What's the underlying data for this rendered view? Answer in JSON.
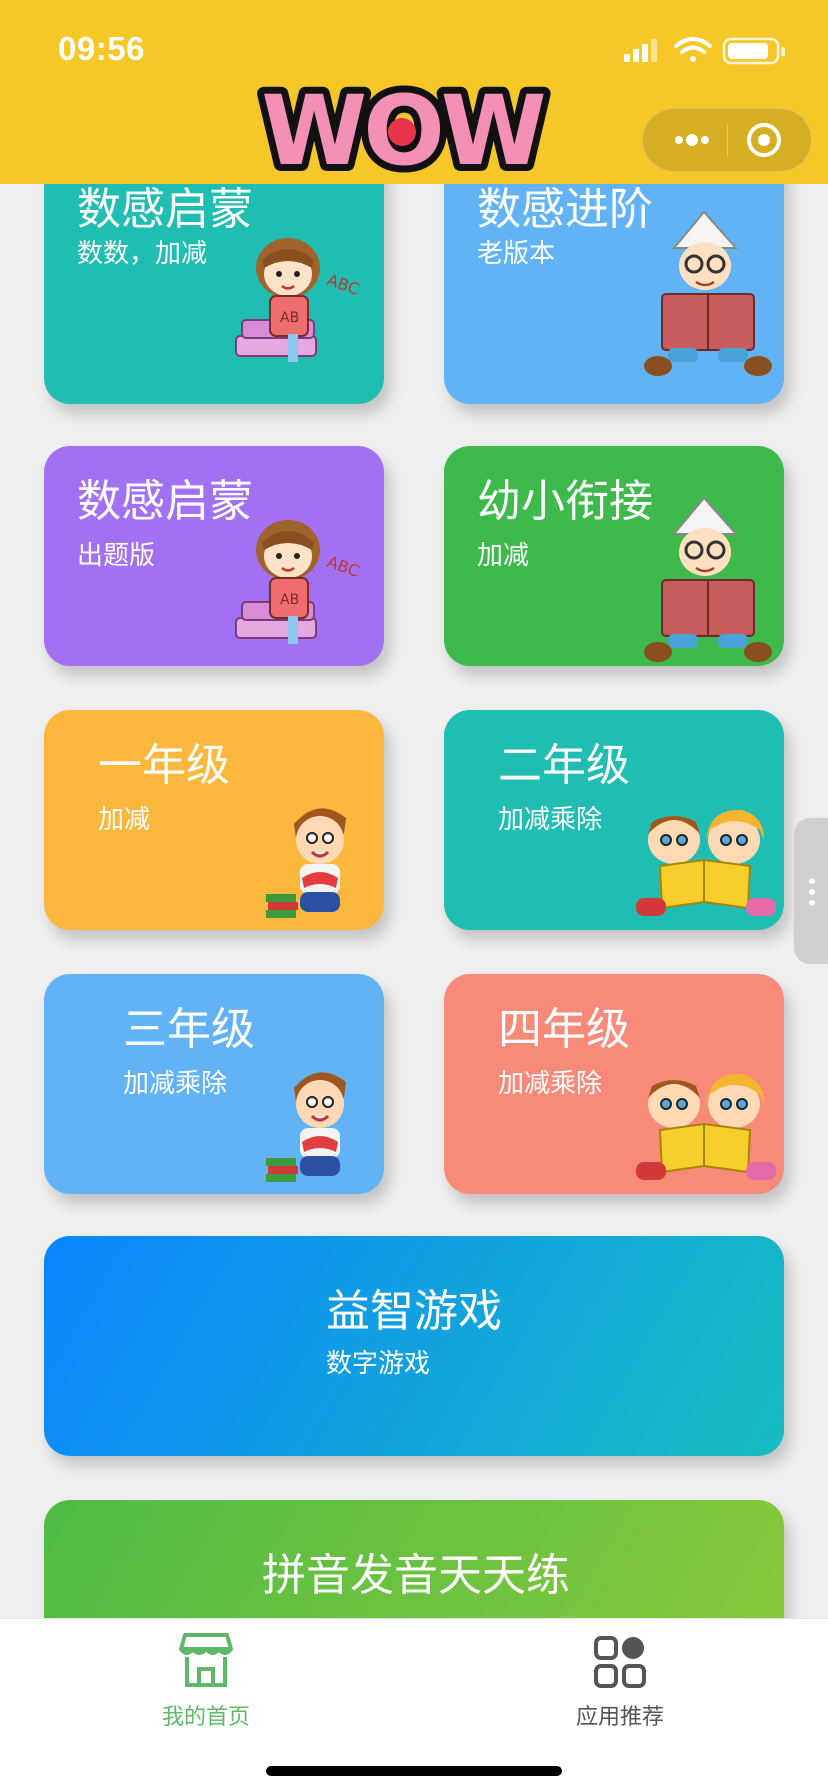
{
  "status_bar": {
    "time": "09:56"
  },
  "header": {
    "logo_text": "WOW",
    "capsule": {
      "more_icon": "more-dots-icon",
      "close_icon": "target-circle-icon"
    }
  },
  "cards": [
    {
      "title": "数感启蒙",
      "subtitle": "数数，加减",
      "color": "#1fbdb2",
      "illustration": "girl-reading-icon"
    },
    {
      "title": "数感进阶",
      "subtitle": "老版本",
      "color": "#62b3f6",
      "illustration": "boy-reading-hat-icon"
    },
    {
      "title": "数感启蒙",
      "subtitle": "出题版",
      "color": "#a271f3",
      "illustration": "girl-reading-icon"
    },
    {
      "title": "幼小衔接",
      "subtitle": "加减",
      "color": "#3eb94b",
      "illustration": "boy-reading-hat-icon"
    },
    {
      "title": "一年级",
      "subtitle": "加减",
      "color": "#fbb83c",
      "illustration": "boy-with-books-icon"
    },
    {
      "title": "二年级",
      "subtitle": "加减乘除",
      "color": "#1fbdb2",
      "illustration": "two-kids-reading-icon"
    },
    {
      "title": "三年级",
      "subtitle": "加减乘除",
      "color": "#62b3f6",
      "illustration": "boy-with-books-icon"
    },
    {
      "title": "四年级",
      "subtitle": "加减乘除",
      "color": "#f78a78",
      "illustration": "two-kids-reading-icon"
    },
    {
      "title": "益智游戏",
      "subtitle": "数字游戏",
      "gradient": [
        "#0a86ff",
        "#18bcc0"
      ]
    },
    {
      "title": "拼音发音天天练",
      "subtitle": "",
      "gradient": [
        "#4fbb45",
        "#8ac93a"
      ]
    }
  ],
  "tabbar": {
    "items": [
      {
        "label": "我的首页",
        "icon": "store-home-icon",
        "active": true,
        "color": "#5db86a"
      },
      {
        "label": "应用推荐",
        "icon": "apps-grid-icon",
        "active": false,
        "color": "#555555"
      }
    ]
  }
}
